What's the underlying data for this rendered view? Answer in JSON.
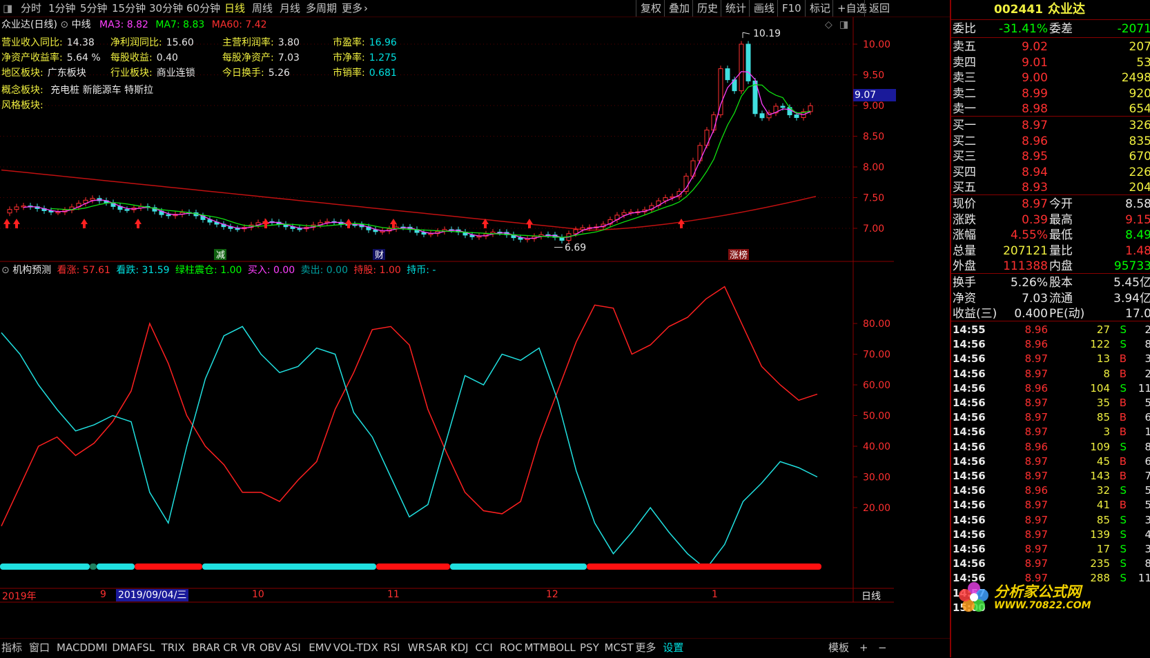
{
  "toolbar": {
    "left_items": [
      "分时",
      "1分钟",
      "5分钟",
      "15分钟",
      "30分钟",
      "60分钟",
      "日线",
      "周线",
      "月线",
      "多周期",
      "更多"
    ],
    "active": "日线",
    "right_items": [
      "复权",
      "叠加",
      "历史",
      "统计",
      "画线",
      "F10",
      "标记",
      "+自选",
      "返回"
    ]
  },
  "header": {
    "title": "众业达(日线)",
    "indicator": "中线",
    "ma3": "MA3: 8.82",
    "ma7": "MA7: 8.83",
    "ma60": "MA60: 7.42"
  },
  "fundamentals": {
    "row1": [
      {
        "label": "营业收入同比:",
        "value": "14.38"
      },
      {
        "label": "净利润同比:",
        "value": "15.60"
      },
      {
        "label": "主营利润率:",
        "value": "3.80"
      },
      {
        "label": "市盈率:",
        "value": "16.96"
      }
    ],
    "row2": [
      {
        "label": "净资产收益率:",
        "value": "5.64 %"
      },
      {
        "label": "每股收益:",
        "value": "0.40"
      },
      {
        "label": "每股净资产:",
        "value": "7.03"
      },
      {
        "label": "市净率:",
        "value": "1.275"
      }
    ],
    "row3": [
      {
        "label": "地区板块:",
        "value": "广东板块"
      },
      {
        "label": "行业板块:",
        "value": "商业连锁"
      },
      {
        "label": "今日换手:",
        "value": "5.26"
      },
      {
        "label": "市销率:",
        "value": "0.681"
      }
    ],
    "concept_label": "概念板块:",
    "concept_value": "充电桩 新能源车 特斯拉",
    "style_label": "风格板块:"
  },
  "price_axis": {
    "ticks": [
      "10.00",
      "9.50",
      "9.00",
      "8.50",
      "8.00",
      "7.50",
      "7.00"
    ],
    "current_tag": "9.07",
    "high_label": "10.19",
    "low_label": "6.69"
  },
  "markers": {
    "jian": "减",
    "cai": "财",
    "zhangbang": "涨榜"
  },
  "indicator_panel": {
    "title": "机构预测",
    "kanzhang": "看涨: 57.61",
    "kandie": "看跌: 31.59",
    "lvzhu": "绿柱震仓: 1.00",
    "mairu": "买入: 0.00",
    "maichu": "卖出: 0.00",
    "chigu": "持股: 1.00",
    "chibi": "持币: -",
    "ticks": [
      "80.00",
      "70.00",
      "60.00",
      "50.00",
      "40.00",
      "30.00",
      "20.00"
    ]
  },
  "date_axis": {
    "labels": [
      "2019年",
      "9",
      "10",
      "11",
      "12",
      "1"
    ],
    "cursor_date": "2019/09/04/三",
    "period": "日线"
  },
  "chart_data": {
    "type": "line",
    "x": [
      "2019-08",
      "2019-09",
      "2019-10",
      "2019-11",
      "2019-12",
      "2020-01"
    ],
    "series": [
      {
        "name": "看涨",
        "color": "#ff2020",
        "values": [
          14,
          27,
          40,
          43,
          37,
          41,
          48,
          58,
          80,
          67,
          50,
          40,
          34,
          25,
          25,
          22,
          29,
          35,
          52,
          64,
          78,
          79,
          73,
          52,
          38,
          25,
          19,
          18,
          22,
          42,
          58,
          74,
          86,
          85,
          70,
          73,
          79,
          82,
          88,
          92,
          79,
          66,
          60,
          55,
          57
        ]
      },
      {
        "name": "看跌",
        "color": "#20e0e0",
        "values": [
          77,
          70,
          60,
          52,
          45,
          47,
          50,
          48,
          25,
          15,
          40,
          62,
          76,
          79,
          70,
          64,
          66,
          72,
          70,
          51,
          43,
          30,
          17,
          21,
          42,
          63,
          60,
          70,
          68,
          72,
          55,
          32,
          15,
          5,
          12,
          20,
          12,
          5,
          0,
          8,
          22,
          28,
          35,
          33,
          30
        ]
      }
    ],
    "price": {
      "ma60_start": 7.95,
      "ma60_end": 7.42,
      "high": 10.19,
      "low": 6.69,
      "last": 8.97
    },
    "ylim": [
      0,
      100
    ]
  },
  "quote": {
    "code": "002441",
    "name": "众业达",
    "weibi_label": "委比",
    "weibi": "-31.41%",
    "weicha_label": "委差",
    "weicha": "-2071",
    "asks": [
      {
        "label": "卖五",
        "price": "9.02",
        "vol": "207"
      },
      {
        "label": "卖四",
        "price": "9.01",
        "vol": "53"
      },
      {
        "label": "卖三",
        "price": "9.00",
        "vol": "2498"
      },
      {
        "label": "卖二",
        "price": "8.99",
        "vol": "920"
      },
      {
        "label": "卖一",
        "price": "8.98",
        "vol": "654"
      }
    ],
    "bids": [
      {
        "label": "买一",
        "price": "8.97",
        "vol": "326"
      },
      {
        "label": "买二",
        "price": "8.96",
        "vol": "835"
      },
      {
        "label": "买三",
        "price": "8.95",
        "vol": "670"
      },
      {
        "label": "买四",
        "price": "8.94",
        "vol": "226"
      },
      {
        "label": "买五",
        "price": "8.93",
        "vol": "204"
      }
    ],
    "stats": [
      {
        "l1": "现价",
        "v1": "8.97",
        "c1": "#ff3030",
        "l2": "今开",
        "v2": "8.58",
        "c2": "#e8e8e8"
      },
      {
        "l1": "涨跌",
        "v1": "0.39",
        "c1": "#ff3030",
        "l2": "最高",
        "v2": "9.15",
        "c2": "#ff3030"
      },
      {
        "l1": "涨幅",
        "v1": "4.55%",
        "c1": "#ff3030",
        "l2": "最低",
        "v2": "8.49",
        "c2": "#00ff00"
      },
      {
        "l1": "总量",
        "v1": "207121",
        "c1": "#f0f040",
        "l2": "量比",
        "v2": "1.48",
        "c2": "#ff3030"
      },
      {
        "l1": "外盘",
        "v1": "111388",
        "c1": "#ff3030",
        "l2": "内盘",
        "v2": "95733",
        "c2": "#00ff00"
      }
    ],
    "stats2": [
      {
        "l1": "换手",
        "v1": "5.26%",
        "l2": "股本",
        "v2": "5.45亿"
      },
      {
        "l1": "净资",
        "v1": "7.03",
        "l2": "流通",
        "v2": "3.94亿"
      },
      {
        "l1": "收益(三)",
        "v1": "0.400",
        "l2": "PE(动)",
        "v2": "17.0"
      }
    ],
    "ticks": [
      {
        "t": "14:55",
        "p": "8.96",
        "pc": "#ff3030",
        "v": "27",
        "s": "S",
        "n": "2"
      },
      {
        "t": "14:56",
        "p": "8.96",
        "pc": "#ff3030",
        "v": "122",
        "s": "S",
        "n": "8"
      },
      {
        "t": "14:56",
        "p": "8.97",
        "pc": "#ff3030",
        "v": "13",
        "s": "B",
        "n": "3"
      },
      {
        "t": "14:56",
        "p": "8.97",
        "pc": "#ff3030",
        "v": "8",
        "s": "B",
        "n": "2"
      },
      {
        "t": "14:56",
        "p": "8.96",
        "pc": "#ff3030",
        "v": "104",
        "s": "S",
        "n": "11"
      },
      {
        "t": "14:56",
        "p": "8.97",
        "pc": "#ff3030",
        "v": "35",
        "s": "B",
        "n": "5"
      },
      {
        "t": "14:56",
        "p": "8.97",
        "pc": "#ff3030",
        "v": "85",
        "s": "B",
        "n": "6"
      },
      {
        "t": "14:56",
        "p": "8.97",
        "pc": "#ff3030",
        "v": "3",
        "s": "B",
        "n": "1"
      },
      {
        "t": "14:56",
        "p": "8.96",
        "pc": "#ff3030",
        "v": "109",
        "s": "S",
        "n": "8"
      },
      {
        "t": "14:56",
        "p": "8.97",
        "pc": "#ff3030",
        "v": "45",
        "s": "B",
        "n": "6"
      },
      {
        "t": "14:56",
        "p": "8.97",
        "pc": "#ff3030",
        "v": "143",
        "s": "B",
        "n": "7"
      },
      {
        "t": "14:56",
        "p": "8.96",
        "pc": "#ff3030",
        "v": "32",
        "s": "S",
        "n": "5"
      },
      {
        "t": "14:56",
        "p": "8.97",
        "pc": "#ff3030",
        "v": "41",
        "s": "B",
        "n": "5"
      },
      {
        "t": "14:56",
        "p": "8.97",
        "pc": "#ff3030",
        "v": "85",
        "s": "S",
        "n": "3"
      },
      {
        "t": "14:56",
        "p": "8.97",
        "pc": "#ff3030",
        "v": "139",
        "s": "S",
        "n": "4"
      },
      {
        "t": "14:56",
        "p": "8.97",
        "pc": "#ff3030",
        "v": "17",
        "s": "S",
        "n": "3"
      },
      {
        "t": "14:56",
        "p": "8.97",
        "pc": "#ff3030",
        "v": "235",
        "s": "S",
        "n": "8"
      },
      {
        "t": "14:56",
        "p": "8.97",
        "pc": "#ff3030",
        "v": "288",
        "s": "S",
        "n": "11"
      },
      {
        "t": "14:57",
        "p": "",
        "pc": "#ff3030",
        "v": "",
        "s": "",
        "n": ""
      },
      {
        "t": "15:00",
        "p": "",
        "pc": "#ff3030",
        "v": "",
        "s": "",
        "n": ""
      }
    ],
    "watermark": "分析家公式网",
    "watermark_url": "WWW.70822.COM"
  },
  "bottom_tabs": {
    "items": [
      "指标",
      "窗口",
      "MACD",
      "DMI",
      "DMA",
      "FSL",
      "TRIX",
      "BRAR",
      "CR",
      "VR",
      "OBV",
      "ASI",
      "EMV",
      "VOL-TDX",
      "RSI",
      "WR",
      "SAR",
      "KDJ",
      "CCI",
      "ROC",
      "MTM",
      "BOLL",
      "PSY",
      "MCST",
      "更多",
      "设置"
    ],
    "right": [
      "模板",
      "+",
      "−"
    ]
  }
}
